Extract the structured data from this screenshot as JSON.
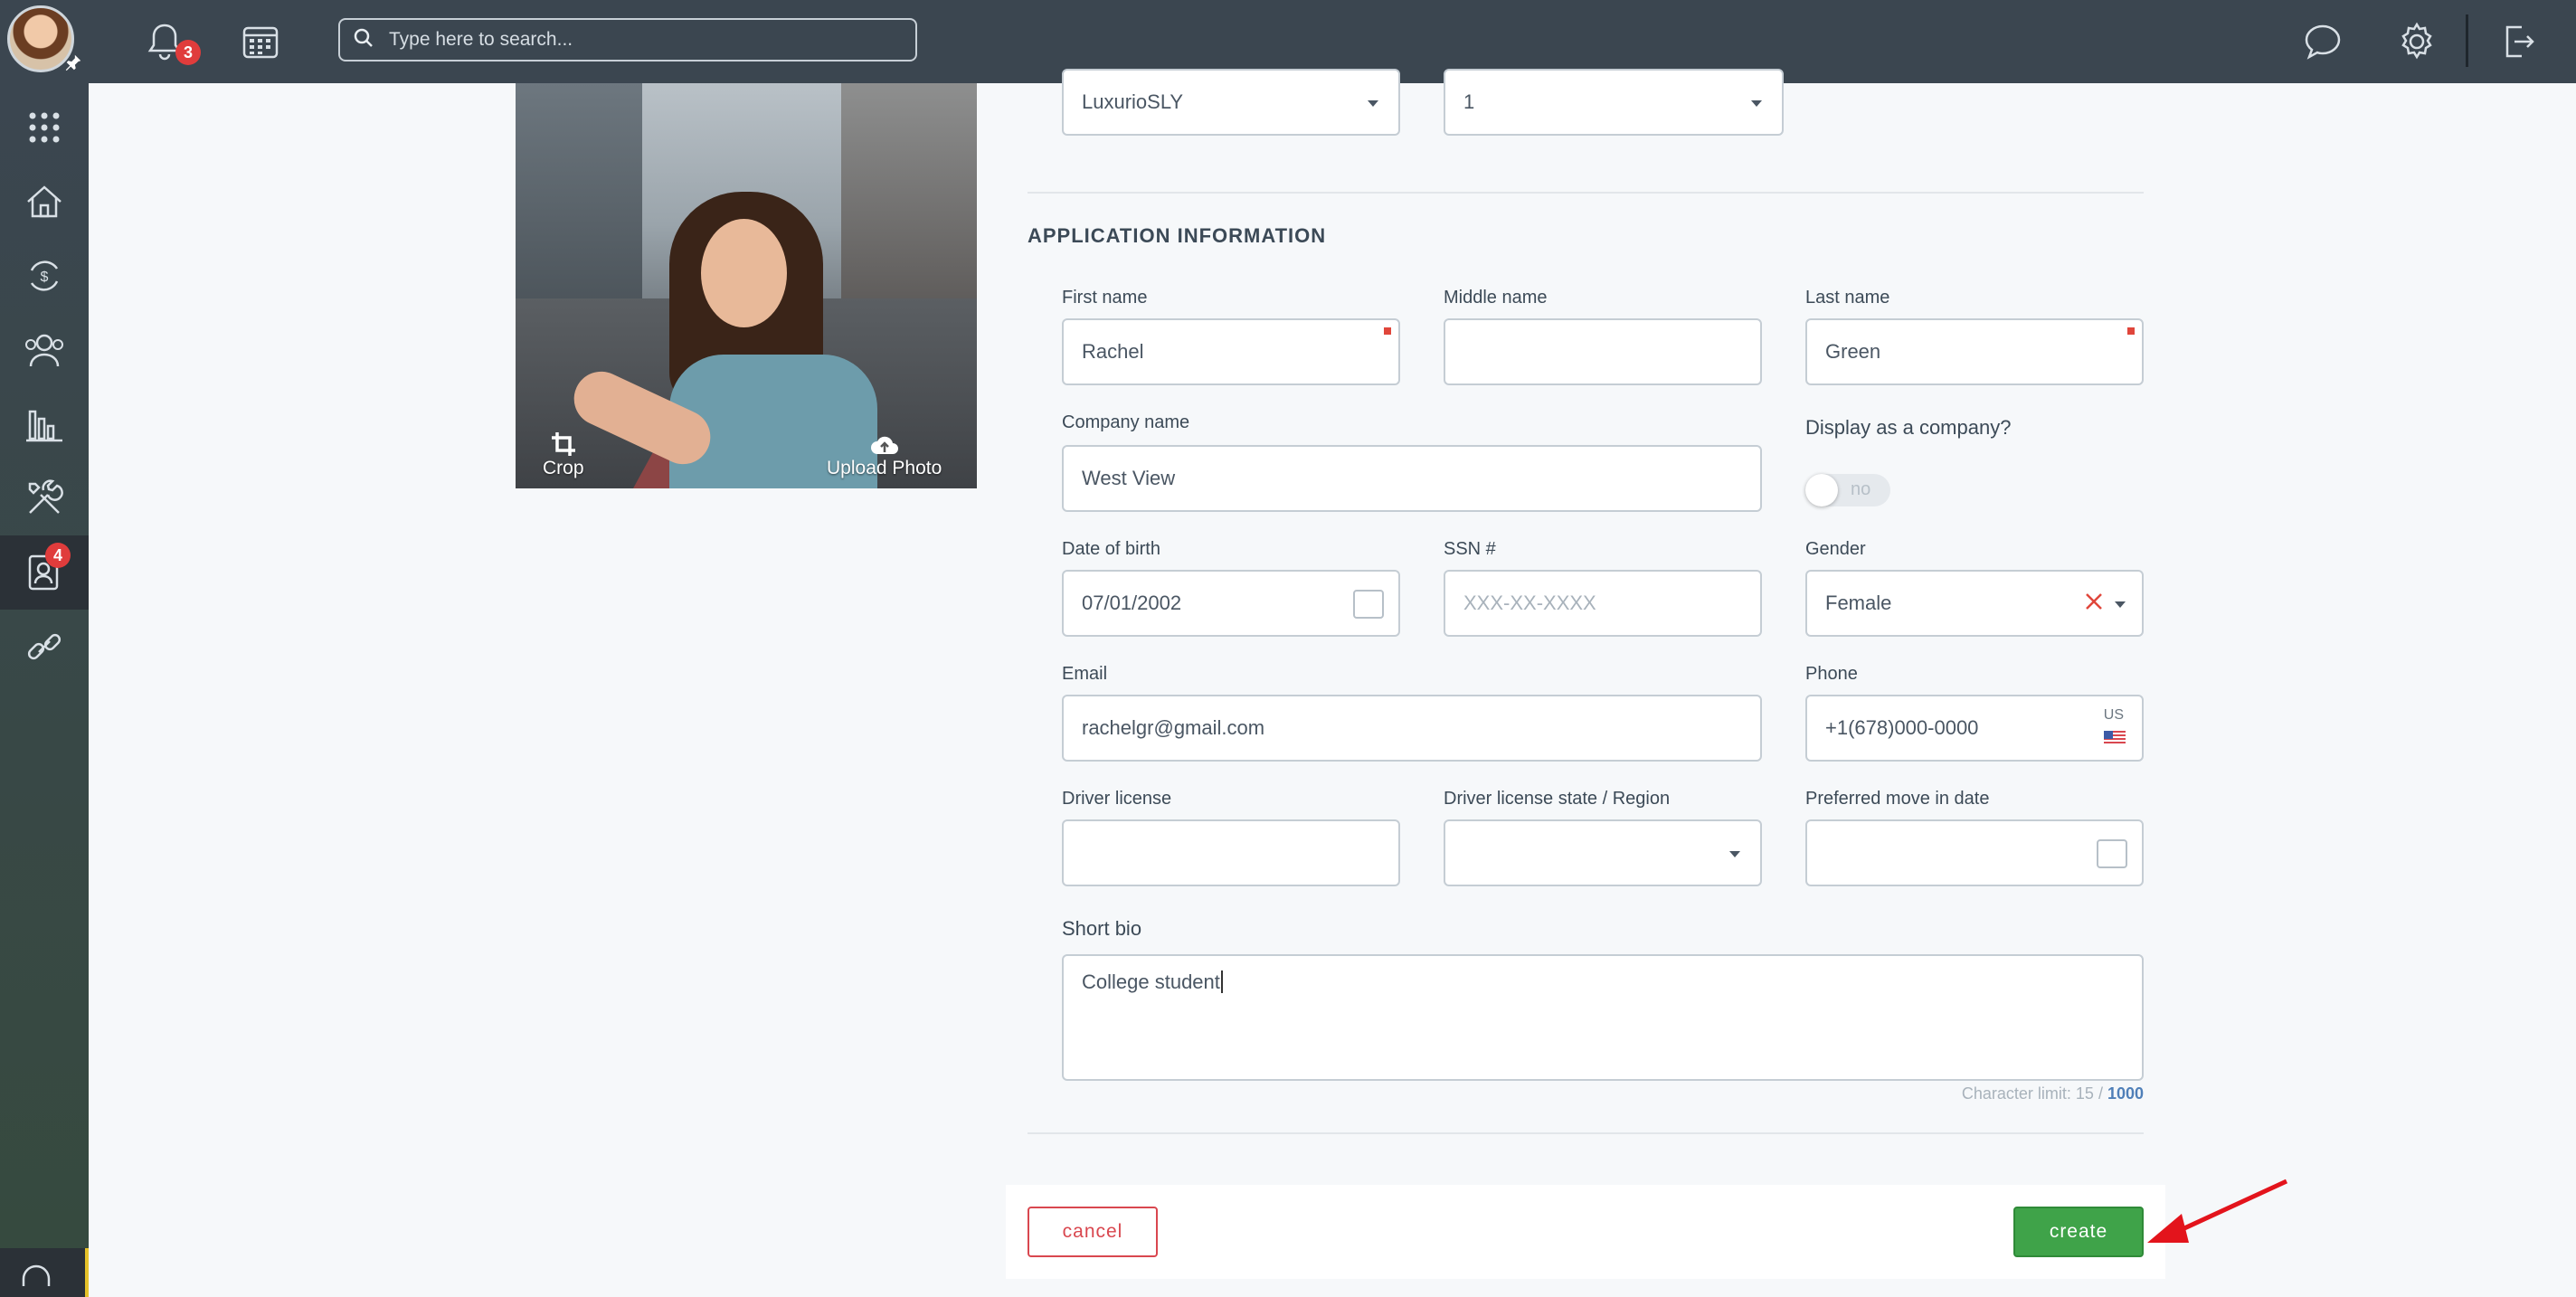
{
  "topbar": {
    "search_placeholder": "Type here to search...",
    "notifications_count": "3"
  },
  "sidebar": {
    "contacts_badge": "4"
  },
  "photo": {
    "crop_label": "Crop",
    "upload_label": "Upload Photo"
  },
  "top_selects": {
    "property_value": "LuxurioSLY",
    "unit_value": "1"
  },
  "section": {
    "title": "APPLICATION INFORMATION"
  },
  "fields": {
    "first_name_label": "First name",
    "first_name_value": "Rachel",
    "middle_name_label": "Middle name",
    "middle_name_value": "",
    "last_name_label": "Last name",
    "last_name_value": "Green",
    "company_name_label": "Company name",
    "company_name_value": "West View",
    "display_company_label": "Display as a company?",
    "display_company_toggle": "no",
    "dob_label": "Date of birth",
    "dob_value": "07/01/2002",
    "ssn_label": "SSN #",
    "ssn_placeholder": "XXX-XX-XXXX",
    "gender_label": "Gender",
    "gender_value": "Female",
    "email_label": "Email",
    "email_value": "rachelgr@gmail.com",
    "phone_label": "Phone",
    "phone_value": "+1(678)000-0000",
    "phone_country": "US",
    "driver_license_label": "Driver license",
    "driver_license_value": "",
    "dl_state_label": "Driver license state / Region",
    "dl_state_value": "",
    "move_in_label": "Preferred move in date",
    "move_in_value": ""
  },
  "bio": {
    "label": "Short bio",
    "value": "College student",
    "char_limit_text": "Character limit: 15 / ",
    "char_limit_max": "1000"
  },
  "actions": {
    "cancel_label": "cancel",
    "create_label": "create"
  },
  "colors": {
    "topbar": "#3b4650",
    "create_button": "#3fa349",
    "cancel_button": "#d9474f",
    "badge": "#e03c3c",
    "annotation_arrow": "#e3141c"
  }
}
